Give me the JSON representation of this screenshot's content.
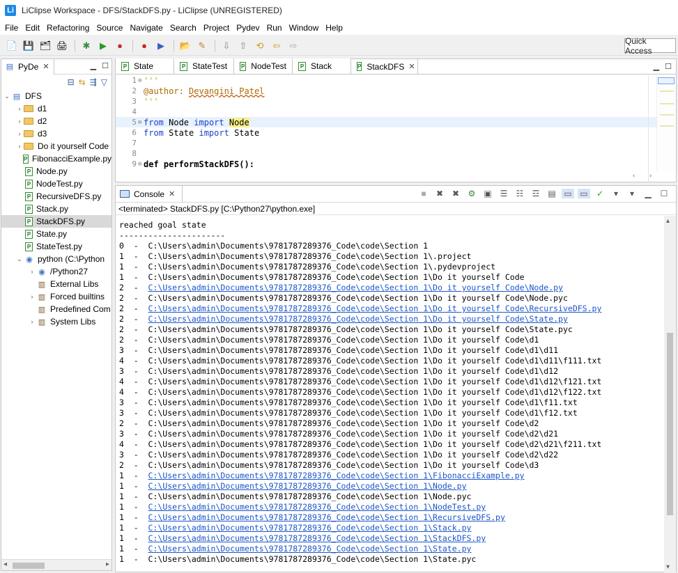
{
  "window": {
    "title": "LiClipse Workspace - DFS/StackDFS.py - LiClipse (UNREGISTERED)",
    "app_icon": "Li"
  },
  "menu": [
    {
      "label": "File",
      "u": "F",
      "rest": "ile"
    },
    {
      "label": "Edit",
      "u": "E",
      "rest": "dit"
    },
    {
      "label": "Refactoring",
      "u": "",
      "rest": "Refactoring"
    },
    {
      "label": "Source",
      "u": "S",
      "rest": "ource"
    },
    {
      "label": "Navigate",
      "u": "N",
      "rest": "avigate"
    },
    {
      "label": "Search",
      "u": "",
      "rest": "Search"
    },
    {
      "label": "Project",
      "u": "P",
      "rest": "roject"
    },
    {
      "label": "Pydev",
      "u": "",
      "rest": "Pydev"
    },
    {
      "label": "Run",
      "u": "R",
      "rest": "un"
    },
    {
      "label": "Window",
      "u": "W",
      "rest": "indow"
    },
    {
      "label": "Help",
      "u": "H",
      "rest": "elp"
    }
  ],
  "toolbar": {
    "quick_access": "Quick Access"
  },
  "left_panel": {
    "tab_label": "PyDe",
    "tree": [
      {
        "indent": 0,
        "chev": "v",
        "icon": "project-icon",
        "label": "DFS"
      },
      {
        "indent": 1,
        "chev": ">",
        "icon": "folder-icon",
        "label": "d1"
      },
      {
        "indent": 1,
        "chev": ">",
        "icon": "folder-icon",
        "label": "d2"
      },
      {
        "indent": 1,
        "chev": ">",
        "icon": "folder-icon",
        "label": "d3"
      },
      {
        "indent": 1,
        "chev": ">",
        "icon": "folder-icon",
        "label": "Do it yourself Code"
      },
      {
        "indent": 1,
        "chev": "",
        "icon": "pyfile-icon",
        "label": "FibonacciExample.py"
      },
      {
        "indent": 1,
        "chev": "",
        "icon": "pyfile-icon",
        "label": "Node.py"
      },
      {
        "indent": 1,
        "chev": "",
        "icon": "pyfile-icon",
        "label": "NodeTest.py"
      },
      {
        "indent": 1,
        "chev": "",
        "icon": "pyfile-icon",
        "label": "RecursiveDFS.py"
      },
      {
        "indent": 1,
        "chev": "",
        "icon": "pyfile-icon",
        "label": "Stack.py"
      },
      {
        "indent": 1,
        "chev": "",
        "icon": "pyfile-icon",
        "label": "StackDFS.py",
        "selected": true
      },
      {
        "indent": 1,
        "chev": "",
        "icon": "pyfile-icon",
        "label": "State.py"
      },
      {
        "indent": 1,
        "chev": "",
        "icon": "pyfile-icon",
        "label": "StateTest.py"
      },
      {
        "indent": 1,
        "chev": "v",
        "icon": "python-icon",
        "label": "python  (C:\\Python"
      },
      {
        "indent": 2,
        "chev": ">",
        "icon": "python-icon",
        "label": "/Python27"
      },
      {
        "indent": 2,
        "chev": "",
        "icon": "library-icon",
        "label": "External Libs"
      },
      {
        "indent": 2,
        "chev": ">",
        "icon": "library-icon",
        "label": "Forced builtins"
      },
      {
        "indent": 2,
        "chev": "",
        "icon": "library-icon",
        "label": "Predefined Com"
      },
      {
        "indent": 2,
        "chev": ">",
        "icon": "library-icon",
        "label": "System Libs"
      }
    ]
  },
  "editor": {
    "tabs": [
      {
        "label": "State",
        "active": false
      },
      {
        "label": "StateTest",
        "active": false
      },
      {
        "label": "NodeTest",
        "active": false
      },
      {
        "label": "Stack",
        "active": false
      },
      {
        "label": "StackDFS",
        "active": true
      }
    ],
    "line_numbers": [
      "1",
      "2",
      "3",
      "4",
      "5",
      "6",
      "7",
      "8",
      "9"
    ],
    "lines": {
      "l1": "'''",
      "l2_tag": "@author:",
      "l2_name": "Devangini Patel",
      "l3": "'''",
      "l5_from": "from",
      "l5_mod": " Node ",
      "l5_import": "import",
      "l5_name": "Node",
      "l6_from": "from",
      "l6_mod": " State ",
      "l6_import": "import",
      "l6_name": " State",
      "l9_def": "def",
      "l9_name": " performStackDFS():"
    }
  },
  "console": {
    "tab_label": "Console",
    "status": "<terminated> StackDFS.py [C:\\Python27\\python.exe]",
    "output": [
      {
        "t": "reached goal state",
        "link": false
      },
      {
        "t": "----------------------",
        "link": false
      },
      {
        "t": "0  -  C:\\Users\\admin\\Documents\\9781787289376_Code\\code\\Section 1",
        "link": false
      },
      {
        "t": "1  -  C:\\Users\\admin\\Documents\\9781787289376_Code\\code\\Section 1\\.project",
        "link": false
      },
      {
        "t": "1  -  C:\\Users\\admin\\Documents\\9781787289376_Code\\code\\Section 1\\.pydevproject",
        "link": false
      },
      {
        "t": "1  -  C:\\Users\\admin\\Documents\\9781787289376_Code\\code\\Section 1\\Do it yourself Code",
        "link": false
      },
      {
        "p": "2  -  ",
        "t": "C:\\Users\\admin\\Documents\\9781787289376_Code\\code\\Section 1\\Do it yourself Code\\Node.py",
        "link": true
      },
      {
        "t": "2  -  C:\\Users\\admin\\Documents\\9781787289376_Code\\code\\Section 1\\Do it yourself Code\\Node.pyc",
        "link": false
      },
      {
        "p": "2  -  ",
        "t": "C:\\Users\\admin\\Documents\\9781787289376_Code\\code\\Section 1\\Do it yourself Code\\RecursiveDFS.py",
        "link": true
      },
      {
        "p": "2  -  ",
        "t": "C:\\Users\\admin\\Documents\\9781787289376_Code\\code\\Section 1\\Do it yourself Code\\State.py",
        "link": true
      },
      {
        "t": "2  -  C:\\Users\\admin\\Documents\\9781787289376_Code\\code\\Section 1\\Do it yourself Code\\State.pyc",
        "link": false
      },
      {
        "t": "2  -  C:\\Users\\admin\\Documents\\9781787289376_Code\\code\\Section 1\\Do it yourself Code\\d1",
        "link": false
      },
      {
        "t": "3  -  C:\\Users\\admin\\Documents\\9781787289376_Code\\code\\Section 1\\Do it yourself Code\\d1\\d11",
        "link": false
      },
      {
        "t": "4  -  C:\\Users\\admin\\Documents\\9781787289376_Code\\code\\Section 1\\Do it yourself Code\\d1\\d11\\f111.txt",
        "link": false
      },
      {
        "t": "3  -  C:\\Users\\admin\\Documents\\9781787289376_Code\\code\\Section 1\\Do it yourself Code\\d1\\d12",
        "link": false
      },
      {
        "t": "4  -  C:\\Users\\admin\\Documents\\9781787289376_Code\\code\\Section 1\\Do it yourself Code\\d1\\d12\\f121.txt",
        "link": false
      },
      {
        "t": "4  -  C:\\Users\\admin\\Documents\\9781787289376_Code\\code\\Section 1\\Do it yourself Code\\d1\\d12\\f122.txt",
        "link": false
      },
      {
        "t": "3  -  C:\\Users\\admin\\Documents\\9781787289376_Code\\code\\Section 1\\Do it yourself Code\\d1\\f11.txt",
        "link": false
      },
      {
        "t": "3  -  C:\\Users\\admin\\Documents\\9781787289376_Code\\code\\Section 1\\Do it yourself Code\\d1\\f12.txt",
        "link": false
      },
      {
        "t": "2  -  C:\\Users\\admin\\Documents\\9781787289376_Code\\code\\Section 1\\Do it yourself Code\\d2",
        "link": false
      },
      {
        "t": "3  -  C:\\Users\\admin\\Documents\\9781787289376_Code\\code\\Section 1\\Do it yourself Code\\d2\\d21",
        "link": false
      },
      {
        "t": "4  -  C:\\Users\\admin\\Documents\\9781787289376_Code\\code\\Section 1\\Do it yourself Code\\d2\\d21\\f211.txt",
        "link": false
      },
      {
        "t": "3  -  C:\\Users\\admin\\Documents\\9781787289376_Code\\code\\Section 1\\Do it yourself Code\\d2\\d22",
        "link": false
      },
      {
        "t": "2  -  C:\\Users\\admin\\Documents\\9781787289376_Code\\code\\Section 1\\Do it yourself Code\\d3",
        "link": false
      },
      {
        "p": "1  -  ",
        "t": "C:\\Users\\admin\\Documents\\9781787289376_Code\\code\\Section 1\\FibonacciExample.py",
        "link": true
      },
      {
        "p": "1  -  ",
        "t": "C:\\Users\\admin\\Documents\\9781787289376_Code\\code\\Section 1\\Node.py",
        "link": true
      },
      {
        "t": "1  -  C:\\Users\\admin\\Documents\\9781787289376_Code\\code\\Section 1\\Node.pyc",
        "link": false
      },
      {
        "p": "1  -  ",
        "t": "C:\\Users\\admin\\Documents\\9781787289376_Code\\code\\Section 1\\NodeTest.py",
        "link": true
      },
      {
        "p": "1  -  ",
        "t": "C:\\Users\\admin\\Documents\\9781787289376_Code\\code\\Section 1\\RecursiveDFS.py",
        "link": true
      },
      {
        "p": "1  -  ",
        "t": "C:\\Users\\admin\\Documents\\9781787289376_Code\\code\\Section 1\\Stack.py",
        "link": true
      },
      {
        "p": "1  -  ",
        "t": "C:\\Users\\admin\\Documents\\9781787289376_Code\\code\\Section 1\\StackDFS.py",
        "link": true
      },
      {
        "p": "1  -  ",
        "t": "C:\\Users\\admin\\Documents\\9781787289376_Code\\code\\Section 1\\State.py",
        "link": true
      },
      {
        "t": "1  -  C:\\Users\\admin\\Documents\\9781787289376_Code\\code\\Section 1\\State.pyc",
        "link": false
      }
    ]
  },
  "colors": {
    "link": "#1a55c8",
    "keyword": "#1e40c8",
    "selection": "#d9d9d9",
    "current_line": "#e8f2fe"
  }
}
